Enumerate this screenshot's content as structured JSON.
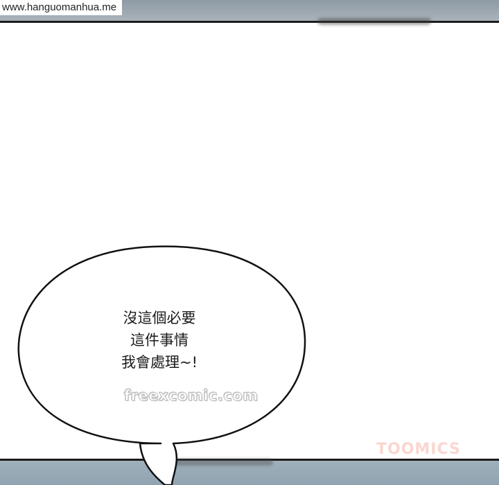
{
  "site_label": "www.hanguomanhua.me",
  "dialogue": {
    "lines": [
      "沒這個必要",
      "這件事情",
      "我會處理~!"
    ]
  },
  "watermarks": {
    "freexcomic": "freexcomic.com",
    "toomics": "TOOMICS"
  }
}
